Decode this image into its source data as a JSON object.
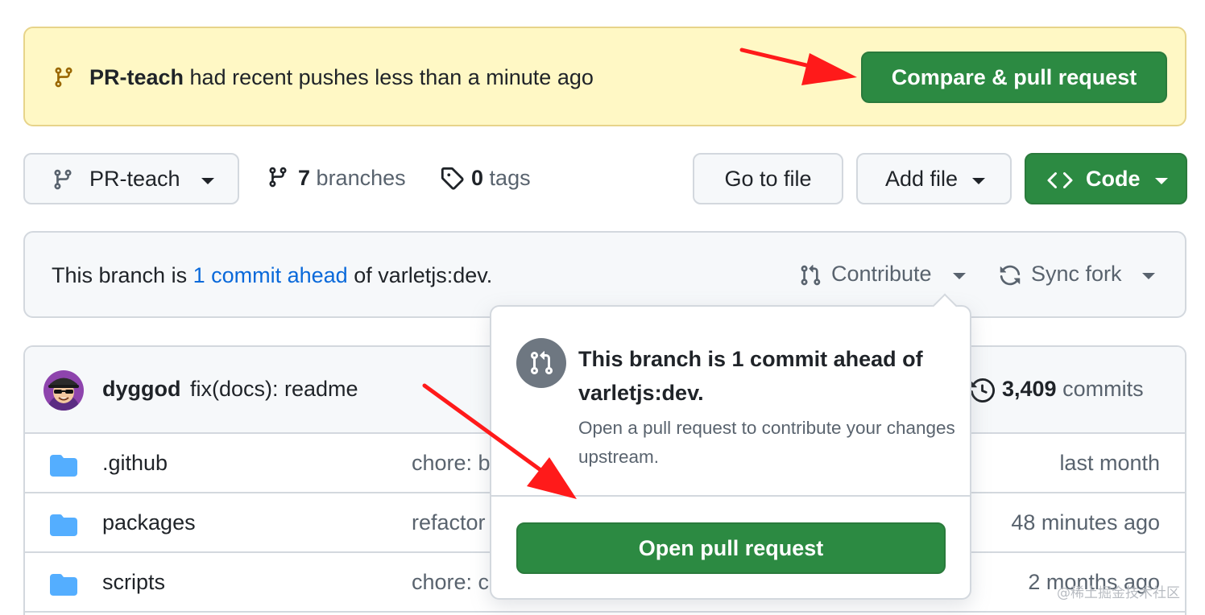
{
  "banner": {
    "branch": "PR-teach",
    "message": " had recent pushes less than a minute ago",
    "button_label": "Compare & pull request",
    "icon": "git-branch-icon"
  },
  "toolbar": {
    "branch_select": "PR-teach",
    "branches_count": "7",
    "branches_label": "branches",
    "tags_count": "0",
    "tags_label": "tags",
    "goto_file": "Go to file",
    "add_file": "Add file",
    "code": "Code"
  },
  "infobar": {
    "prefix": "This branch is ",
    "link": "1 commit ahead",
    "suffix": " of varletjs:dev.",
    "contribute": "Contribute",
    "sync_fork": "Sync fork"
  },
  "latest_commit": {
    "author": "dyggod",
    "message": "fix(docs): readme",
    "commits_count": "3,409",
    "commits_label": "commits"
  },
  "files": [
    {
      "name": ".github",
      "commit": "chore: b",
      "time": "last month"
    },
    {
      "name": "packages",
      "commit": "refactor",
      "time": "48 minutes ago"
    },
    {
      "name": "scripts",
      "commit": "chore: c",
      "time": "2 months ago"
    }
  ],
  "popover": {
    "title": "This branch is 1 commit ahead of varletjs:dev.",
    "description": "Open a pull request to contribute your changes upstream.",
    "button_label": "Open pull request"
  },
  "watermark": "@稀土掘金技术社区",
  "colors": {
    "primary_green": "#2c8a42",
    "banner_bg": "#fff8c5",
    "link_blue": "#0969da",
    "annotation_red": "#ff1a1a"
  }
}
